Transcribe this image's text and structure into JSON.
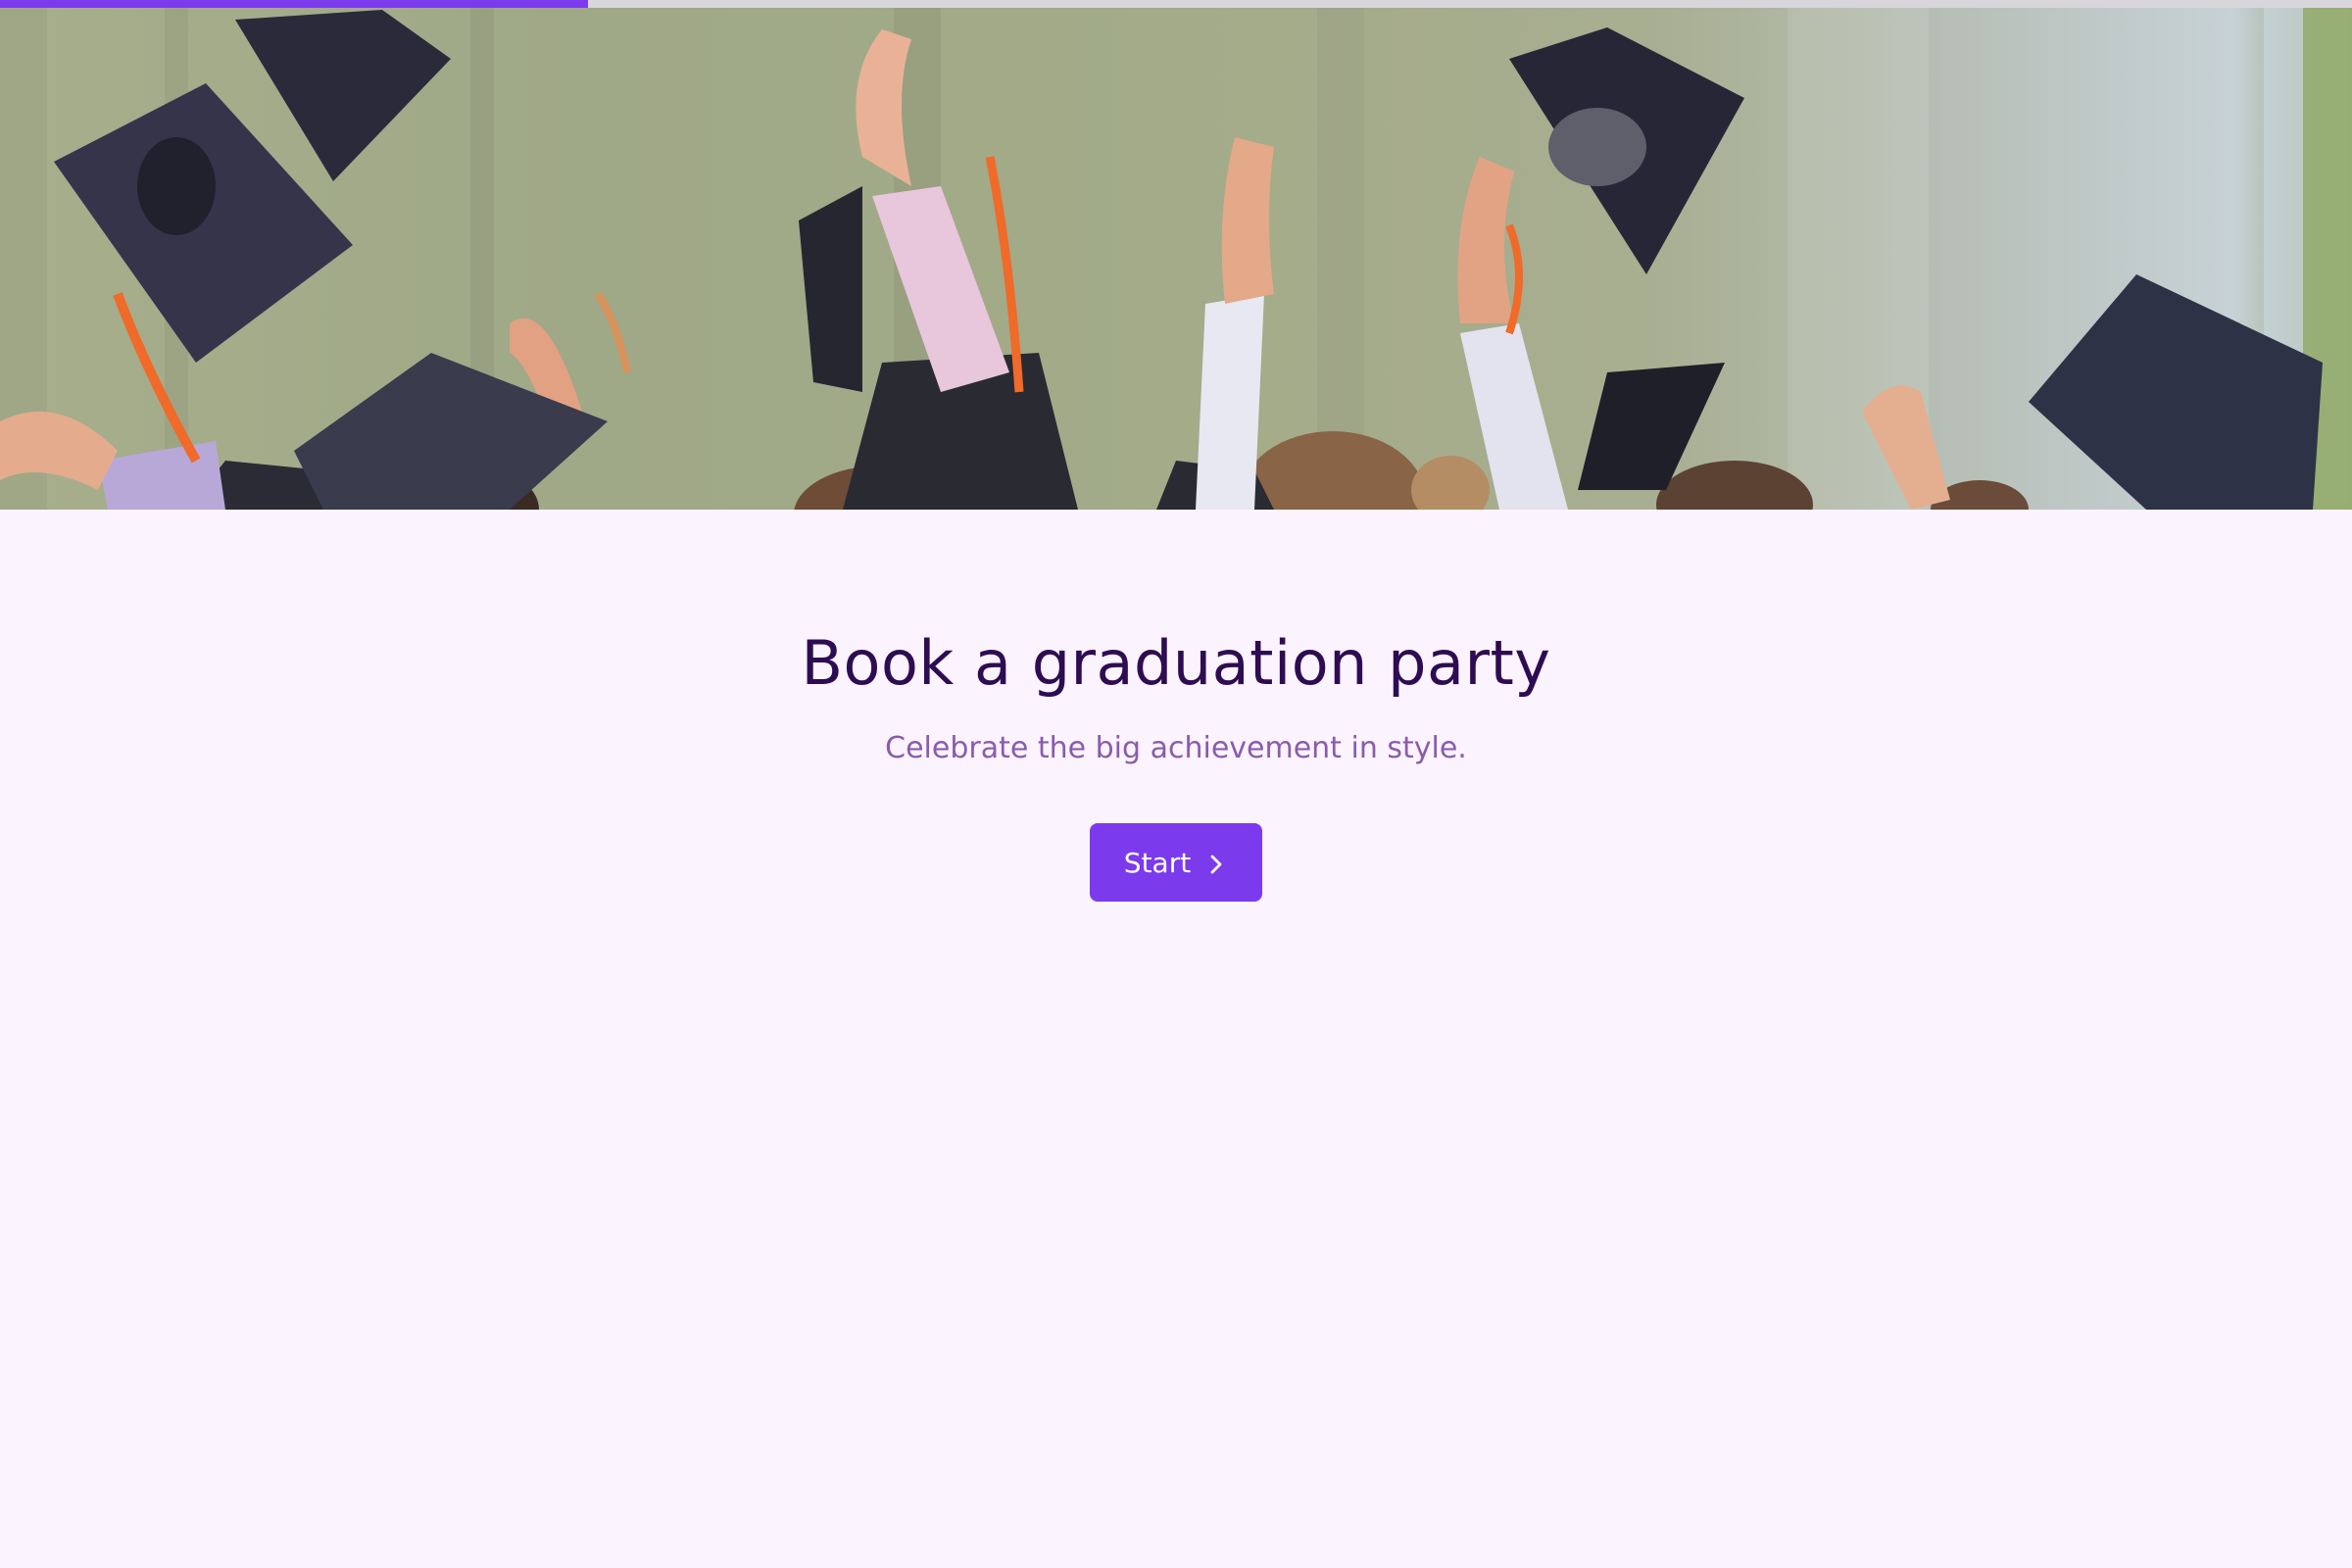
{
  "progress": {
    "value": 0.25,
    "fill_color": "#7c3aed",
    "track_color": "#d9d6db"
  },
  "hero": {
    "description": ""
  },
  "main": {
    "title": "Book a graduation party",
    "subtitle": "Celebrate the big achievement in style.",
    "start_button": {
      "label": "Start",
      "icon": "chevron-right-icon"
    }
  },
  "colors": {
    "background": "#fbf3fd",
    "title": "#2e0c52",
    "subtitle": "#8a5cab",
    "accent": "#7c3aed"
  }
}
